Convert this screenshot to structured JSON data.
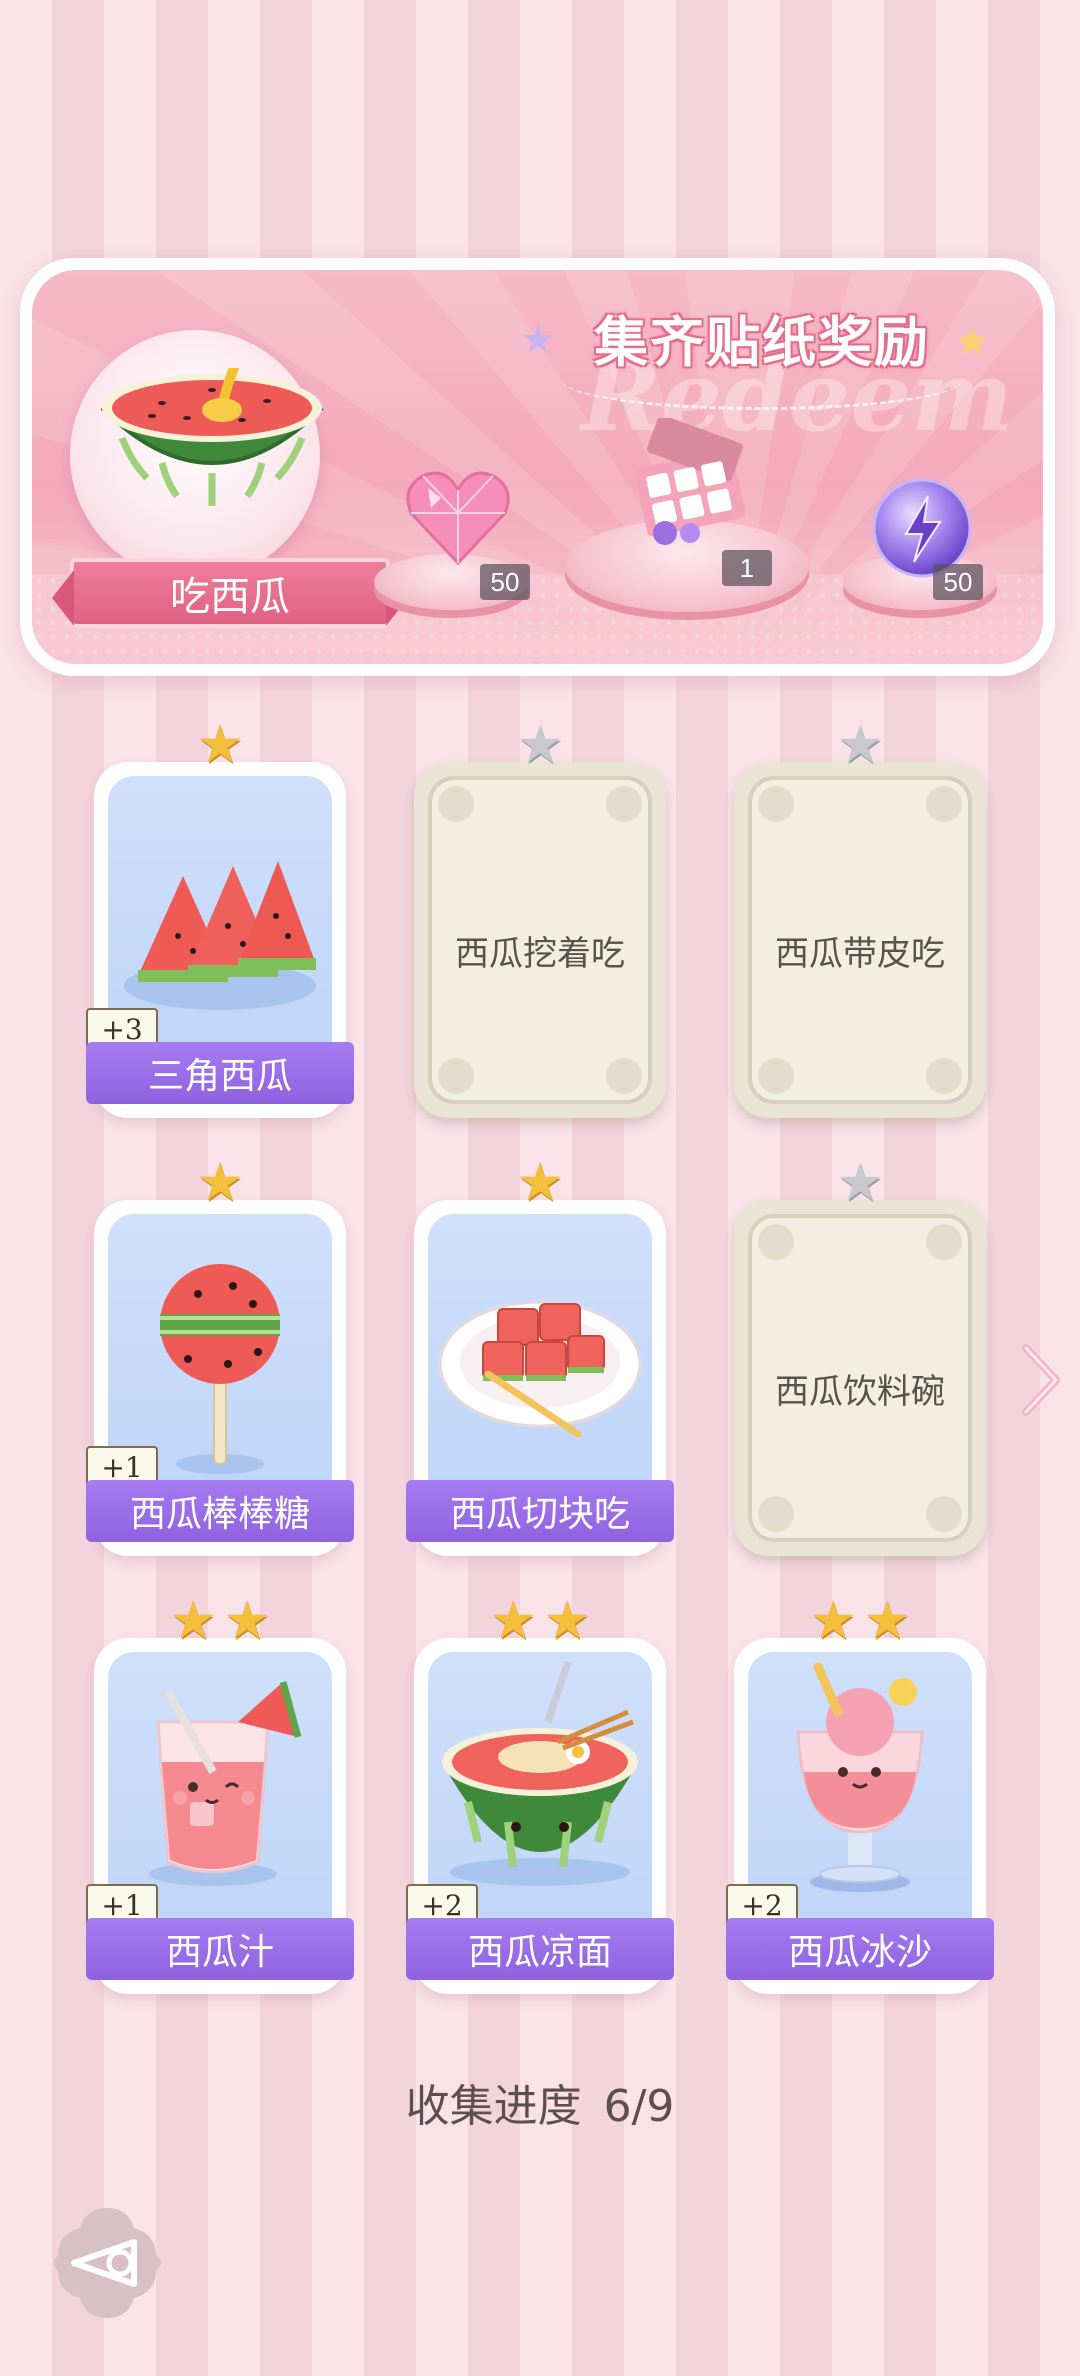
{
  "reward_panel": {
    "title": "集齐贴纸奖励",
    "watermark": "Redeem",
    "album_name": "吃西瓜",
    "rewards": [
      {
        "icon": "pink-heart-gem-icon",
        "count": "50"
      },
      {
        "icon": "gift-box-icon",
        "count": "1"
      },
      {
        "icon": "energy-orb-icon",
        "count": "50"
      }
    ]
  },
  "stickers": [
    {
      "name": "三角西瓜",
      "stars": 1,
      "collected": true,
      "duplicates": "+3"
    },
    {
      "name": "西瓜挖着吃",
      "stars": 1,
      "collected": false,
      "duplicates": ""
    },
    {
      "name": "西瓜带皮吃",
      "stars": 1,
      "collected": false,
      "duplicates": ""
    },
    {
      "name": "西瓜棒棒糖",
      "stars": 1,
      "collected": true,
      "duplicates": "+1"
    },
    {
      "name": "西瓜切块吃",
      "stars": 1,
      "collected": true,
      "duplicates": ""
    },
    {
      "name": "西瓜饮料碗",
      "stars": 1,
      "collected": false,
      "duplicates": ""
    },
    {
      "name": "西瓜汁",
      "stars": 2,
      "collected": true,
      "duplicates": "+1"
    },
    {
      "name": "西瓜凉面",
      "stars": 2,
      "collected": true,
      "duplicates": "+2"
    },
    {
      "name": "西瓜冰沙",
      "stars": 2,
      "collected": true,
      "duplicates": "+2"
    }
  ],
  "progress": {
    "label": "收集进度",
    "value": "6/9"
  },
  "colors": {
    "accent": "#e06184",
    "name_bar": "#9a6ee8",
    "star_gold": "#f4bf3a",
    "star_silver": "#c7c9cf"
  }
}
